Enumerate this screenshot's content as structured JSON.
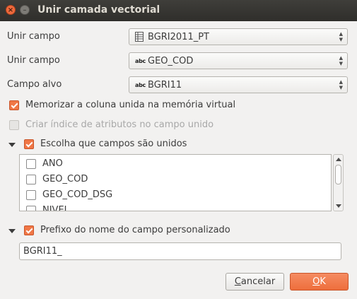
{
  "window": {
    "title": "Unir camada vectorial",
    "close_glyph": "×",
    "minimize_glyph": "–"
  },
  "form": {
    "join_layer": {
      "label": "Unir campo",
      "value": "BGRI2011_PT",
      "icon": "table-icon"
    },
    "join_field": {
      "label": "Unir campo",
      "value": "GEO_COD",
      "icon": "text-field-abc-icon",
      "icon_text": "abc"
    },
    "target_field": {
      "label": "Campo alvo",
      "value": "BGRI11",
      "icon": "text-field-abc-icon",
      "icon_text": "abc"
    }
  },
  "options": {
    "cache_in_memory": {
      "label": "Memorizar a coluna unida na memória virtual",
      "checked": true
    },
    "create_index": {
      "label": "Criar índice de atributos no campo unido",
      "checked": false,
      "enabled": false
    }
  },
  "joined_fields": {
    "label": "Escolha que campos são unidos",
    "checked": true,
    "expanded": true,
    "items": [
      {
        "label": "ANO",
        "checked": false
      },
      {
        "label": "GEO_COD",
        "checked": false
      },
      {
        "label": "GEO_COD_DSG",
        "checked": false
      },
      {
        "label": "NIVEL",
        "checked": false
      }
    ]
  },
  "prefix": {
    "label": "Prefixo do nome do campo personalizado",
    "checked": true,
    "expanded": true,
    "value": "BGRI11_"
  },
  "buttons": {
    "cancel_mnemonic": "C",
    "cancel_rest": "ancelar",
    "ok_mnemonic": "O",
    "ok_rest": "K"
  },
  "colors": {
    "accent": "#f07746",
    "titlebar": "#3c3b37",
    "window_bg": "#f2f1f0"
  }
}
